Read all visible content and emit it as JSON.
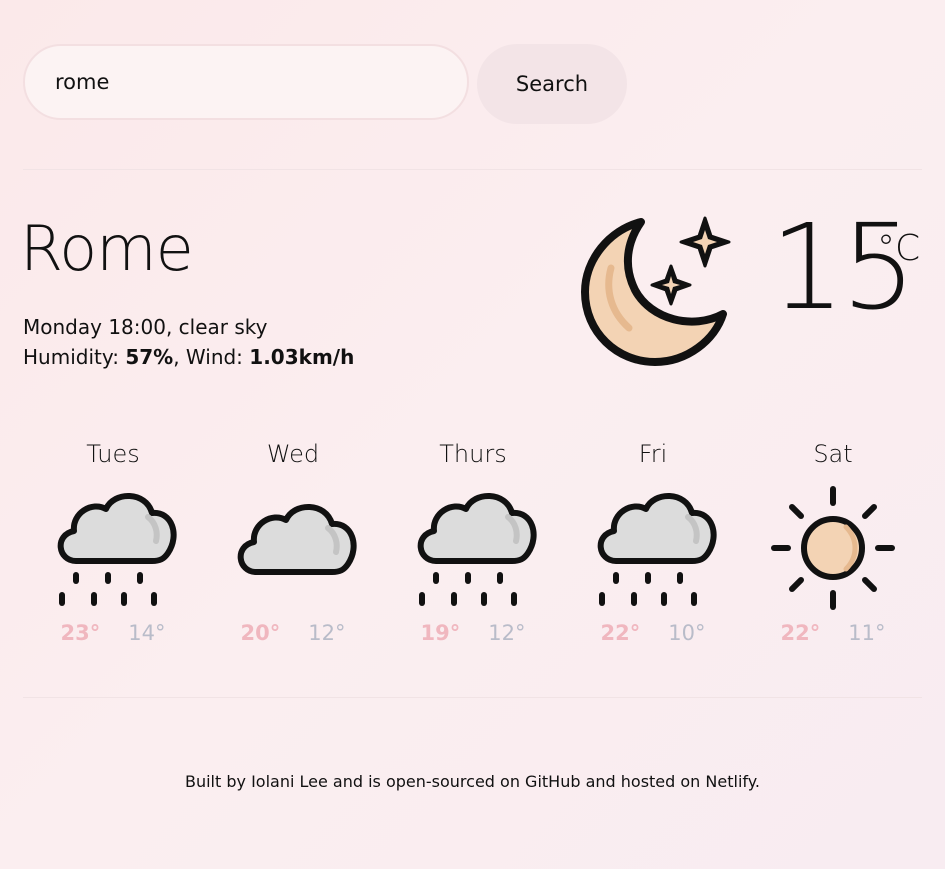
{
  "search": {
    "value": "rome",
    "button_label": "Search"
  },
  "current": {
    "city": "Rome",
    "datetime": "Monday 18:00",
    "description": "clear sky",
    "humidity_label": "Humidity:",
    "humidity_value": "57%",
    "wind_label": "Wind:",
    "wind_value": "1.03km/h",
    "temperature": "15",
    "unit": "°C",
    "icon": "moon-stars-icon"
  },
  "forecast": [
    {
      "day": "Tues",
      "max": "23°",
      "min": "14°",
      "icon": "rain-icon"
    },
    {
      "day": "Wed",
      "max": "20°",
      "min": "12°",
      "icon": "cloud-icon"
    },
    {
      "day": "Thurs",
      "max": "19°",
      "min": "12°",
      "icon": "rain-icon"
    },
    {
      "day": "Fri",
      "max": "22°",
      "min": "10°",
      "icon": "rain-icon"
    },
    {
      "day": "Sat",
      "max": "22°",
      "min": "11°",
      "icon": "sun-icon"
    }
  ],
  "footer": {
    "text": "Built by Iolani Lee and is open-sourced on GitHub and hosted on Netlify."
  },
  "colors": {
    "max_temp": "#f0b7bf",
    "min_temp": "#b9bcc9",
    "icon_fill": "#f3d3b4",
    "cloud_fill": "#dcdcdc"
  }
}
